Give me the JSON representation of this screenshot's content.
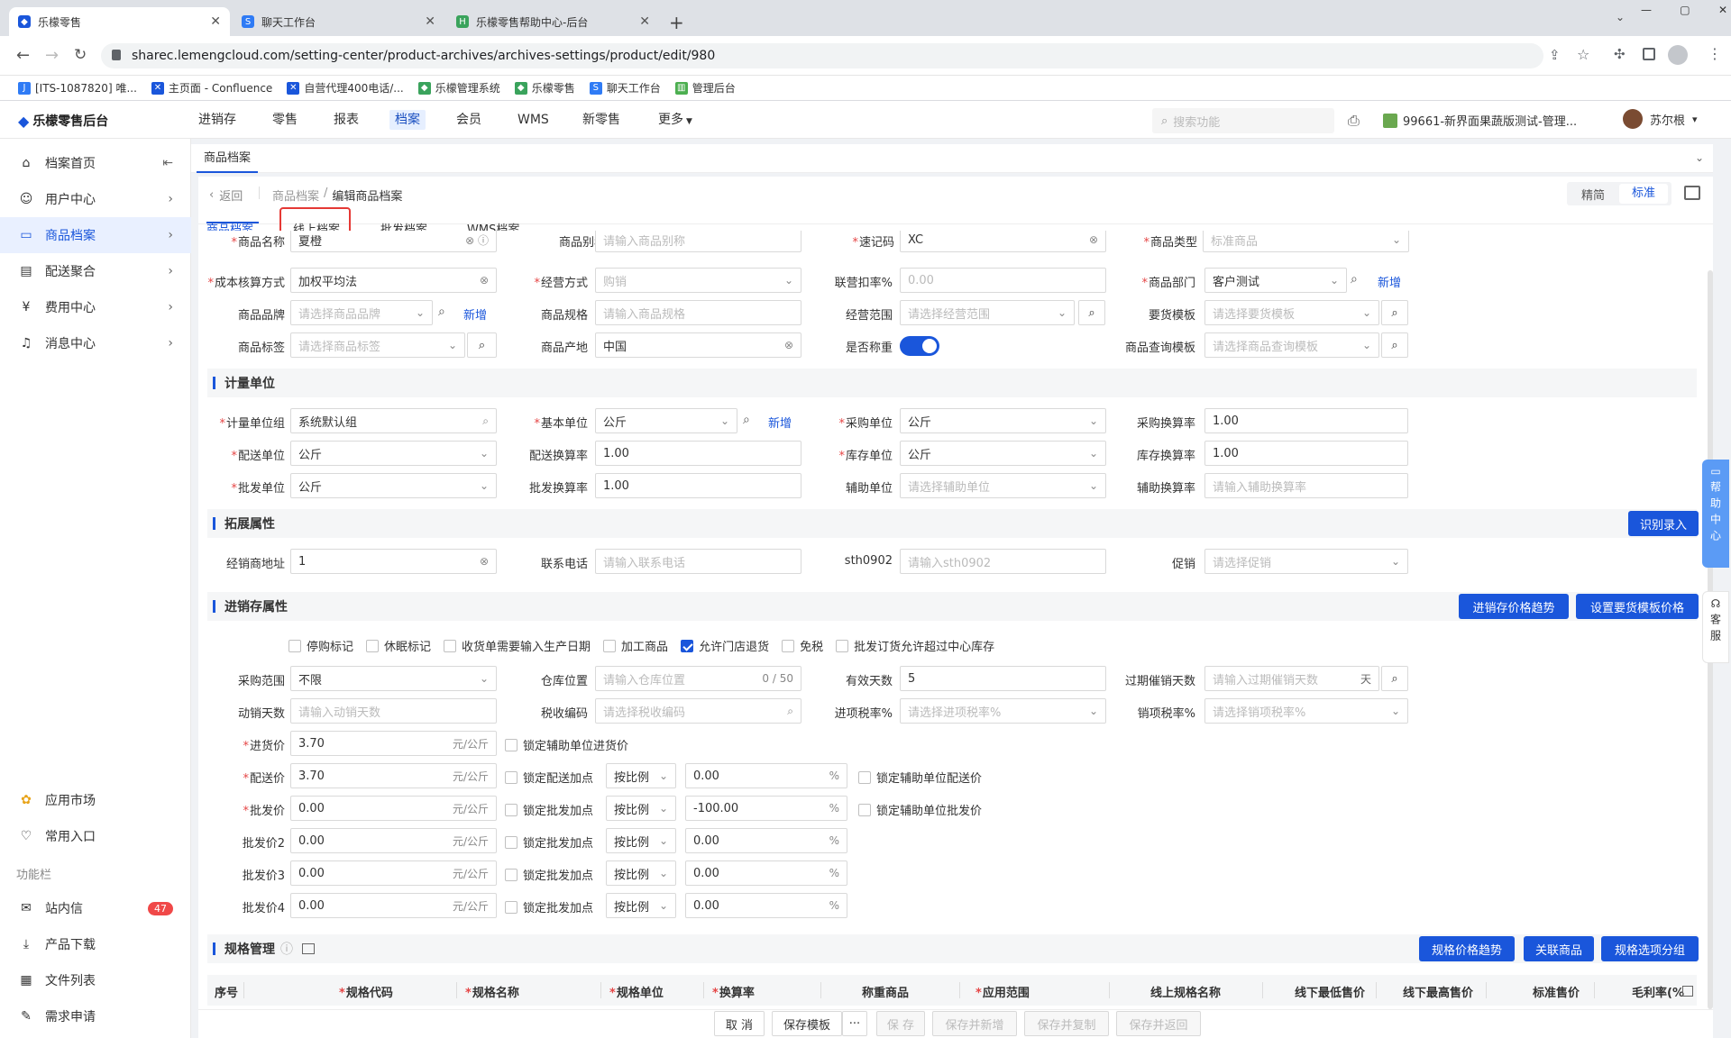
{
  "browser": {
    "tabs": [
      {
        "title": "乐檬零售",
        "icon": "lemeng-icon"
      },
      {
        "title": "聊天工作台",
        "icon": "chat-icon"
      },
      {
        "title": "乐檬零售帮助中心-后台",
        "icon": "help-center-icon"
      }
    ],
    "url": "sharec.lemengcloud.com/setting-center/product-archives/archives-settings/product/edit/980",
    "bookmarks": [
      "[ITS-1087820] 唯...",
      "主页面 - Confluence",
      "自营代理400电话/...",
      "乐檬管理系统",
      "乐檬零售",
      "聊天工作台",
      "管理后台"
    ]
  },
  "app": {
    "brand": "乐檬零售后台",
    "nav": [
      "进销存",
      "零售",
      "报表",
      "档案",
      "会员",
      "WMS",
      "新零售",
      "更多"
    ],
    "search_placeholder": "搜索功能",
    "store": "99661-新界面果蔬版测试-管理...",
    "user": "苏尔根"
  },
  "sidebar": {
    "items": [
      {
        "label": "档案首页",
        "icon": "home-icon"
      },
      {
        "label": "用户中心",
        "icon": "user-icon"
      },
      {
        "label": "商品档案",
        "icon": "product-icon"
      },
      {
        "label": "配送聚合",
        "icon": "delivery-icon"
      },
      {
        "label": "费用中心",
        "icon": "fee-icon"
      },
      {
        "label": "消息中心",
        "icon": "bell-icon"
      }
    ],
    "bottom": [
      {
        "label": "应用市场",
        "icon": "app-market-icon"
      },
      {
        "label": "常用入口",
        "icon": "heart-icon"
      }
    ],
    "section_title": "功能栏",
    "tools": [
      {
        "label": "站内信",
        "icon": "mail-icon",
        "badge": "47"
      },
      {
        "label": "产品下载",
        "icon": "download-icon"
      },
      {
        "label": "文件列表",
        "icon": "file-list-icon"
      },
      {
        "label": "需求申请",
        "icon": "request-icon"
      }
    ]
  },
  "page": {
    "tab": "商品档案",
    "back": "返回",
    "breadcrumb_parent": "商品档案",
    "breadcrumb_current": "编辑商品档案",
    "view_simple": "精简",
    "view_standard": "标准",
    "subtabs": [
      "商品档案",
      "线上档案",
      "批发档案",
      "WMS档案"
    ]
  },
  "basic": {
    "name_label": "商品名称",
    "name_value": "夏橙",
    "alias_label": "商品别称",
    "alias_ph": "请输入商品别称",
    "code_label": "速记码",
    "code_value": "XC",
    "type_label": "商品类型",
    "type_ph": "标准商品",
    "cost_label": "成本核算方式",
    "cost_value": "加权平均法",
    "mode_label": "经营方式",
    "mode_ph": "购销",
    "rate_label": "联营扣率%",
    "rate_ph": "0.00",
    "dept_label": "商品部门",
    "dept_value": "客户测试",
    "dept_add": "新增",
    "brand_label": "商品品牌",
    "brand_ph": "请选择商品品牌",
    "brand_add": "新增",
    "spec_label": "商品规格",
    "spec_ph": "请输入商品规格",
    "scope_label": "经营范围",
    "scope_ph": "请选择经营范围",
    "tpl_label": "要货模板",
    "tpl_ph": "请选择要货模板",
    "tag_label": "商品标签",
    "tag_ph": "请选择商品标签",
    "origin_label": "商品产地",
    "origin_value": "中国",
    "weigh_label": "是否称重",
    "query_label": "商品查询模板",
    "query_ph": "请选择商品查询模板"
  },
  "units": {
    "title": "计量单位",
    "group_label": "计量单位组",
    "group_value": "系统默认组",
    "base_label": "基本单位",
    "base_value": "公斤",
    "base_add": "新增",
    "purchase_label": "采购单位",
    "purchase_value": "公斤",
    "purchase_rate_label": "采购换算率",
    "purchase_rate_value": "1.00",
    "delivery_label": "配送单位",
    "delivery_value": "公斤",
    "delivery_rate_label": "配送换算率",
    "delivery_rate_value": "1.00",
    "stock_label": "库存单位",
    "stock_value": "公斤",
    "stock_rate_label": "库存换算率",
    "stock_rate_value": "1.00",
    "wholesale_label": "批发单位",
    "wholesale_value": "公斤",
    "wholesale_rate_label": "批发换算率",
    "wholesale_rate_value": "1.00",
    "aux_label": "辅助单位",
    "aux_ph": "请选择辅助单位",
    "aux_rate_label": "辅助换算率",
    "aux_rate_ph": "请输入辅助换算率"
  },
  "ext": {
    "title": "拓展属性",
    "recognize_btn": "识别录入",
    "addr_label": "经销商地址",
    "addr_value": "1",
    "phone_label": "联系电话",
    "phone_ph": "请输入联系电话",
    "sth_label": "sth0902",
    "sth_ph": "请输入sth0902",
    "promo_label": "促销",
    "promo_ph": "请选择促销"
  },
  "inv": {
    "title": "进销存属性",
    "trend_btn": "进销存价格趋势",
    "tplprice_btn": "设置要货模板价格",
    "checks": [
      {
        "label": "停购标记",
        "on": false
      },
      {
        "label": "休眠标记",
        "on": false
      },
      {
        "label": "收货单需要输入生产日期",
        "on": false
      },
      {
        "label": "加工商品",
        "on": false
      },
      {
        "label": "允许门店退货",
        "on": true
      },
      {
        "label": "免税",
        "on": false
      },
      {
        "label": "批发订货允许超过中心库存",
        "on": false
      }
    ],
    "range_label": "采购范围",
    "range_value": "不限",
    "loc_label": "仓库位置",
    "loc_ph": "请输入仓库位置",
    "loc_count": "0 / 50",
    "valid_label": "有效天数",
    "valid_value": "5",
    "expire_label": "过期催销天数",
    "expire_ph": "请输入过期催销天数",
    "expire_unit": "天",
    "move_label": "动销天数",
    "move_ph": "请输入动销天数",
    "tax_label": "税收编码",
    "tax_ph": "请选择税收编码",
    "in_tax_label": "进项税率%",
    "in_tax_ph": "请选择进项税率%",
    "out_tax_label": "销项税率%",
    "out_tax_ph": "请选择销项税率%",
    "unit_suffix": "元/公斤",
    "pct": "%",
    "mode": "按比例",
    "purchase_price_label": "进货价",
    "purchase_price": "3.70",
    "lock_aux_purchase": "锁定辅助单位进货价",
    "delivery_price_label": "配送价",
    "delivery_price": "3.70",
    "lock_delivery_add": "锁定配送加点",
    "delivery_pct": "0.00",
    "lock_aux_delivery": "锁定辅助单位配送价",
    "wholesale_price_label": "批发价",
    "wholesale_price": "0.00",
    "lock_wholesale_add": "锁定批发加点",
    "wholesale_pct": "-100.00",
    "lock_aux_wholesale": "锁定辅助单位批发价",
    "w2_label": "批发价2",
    "w2": "0.00",
    "w2_pct": "0.00",
    "w3_label": "批发价3",
    "w3": "0.00",
    "w3_pct": "0.00",
    "w4_label": "批发价4",
    "w4": "0.00",
    "w4_pct": "0.00"
  },
  "spec": {
    "title": "规格管理",
    "btn_trend": "规格价格趋势",
    "btn_link": "关联商品",
    "btn_group": "规格选项分组",
    "columns": [
      "序号",
      "规格代码",
      "规格名称",
      "规格单位",
      "换算率",
      "称重商品",
      "应用范围",
      "线上规格名称",
      "线下最低售价",
      "线下最高售价",
      "标准售价",
      "毛利率(%"
    ]
  },
  "footer": {
    "cancel": "取 消",
    "save_tpl": "保存模板",
    "more": "···",
    "save": "保 存",
    "save_new": "保存并新增",
    "save_copy": "保存并复制",
    "save_back": "保存并返回"
  },
  "float": {
    "help": "帮助中心",
    "service": "客服"
  }
}
